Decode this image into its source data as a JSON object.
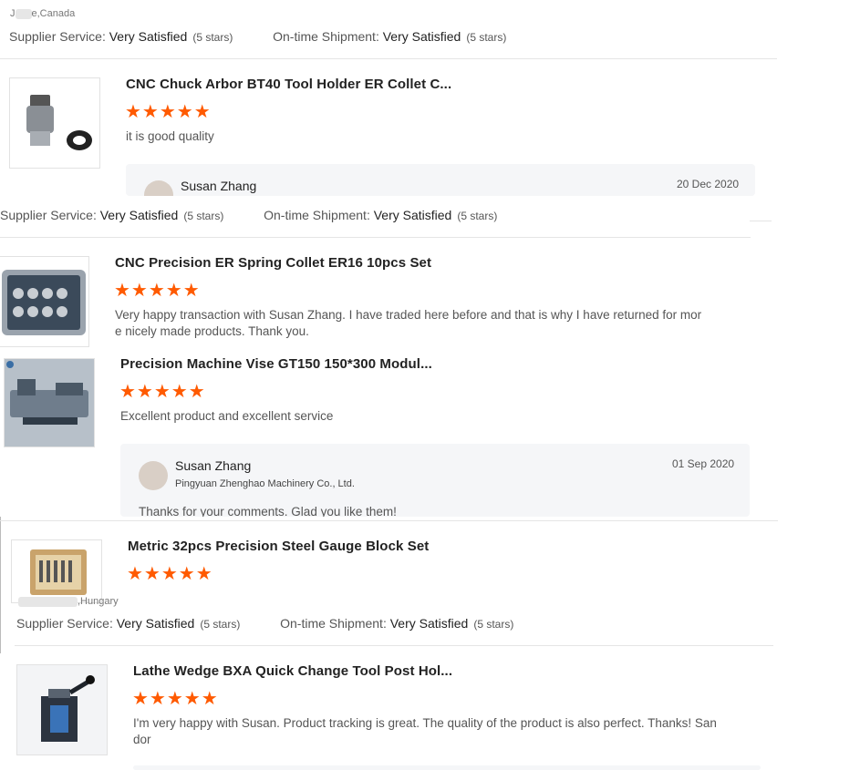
{
  "ratings_labels": {
    "supplier_service": "Supplier Service:",
    "ontime_shipment": "On-time Shipment:",
    "value": "Very Satisfied",
    "stars": "(5 stars)"
  },
  "star_glyphs": "★★★★★",
  "colors": {
    "accent": "#ff5a00",
    "reply_bg": "#f5f6f8"
  },
  "reviews": [
    {
      "location_prefix": "J",
      "location_suffix": "e,Canada"
    },
    {
      "title": "CNC Chuck Arbor BT40 Tool Holder ER Collet C...",
      "comment": "it is good quality",
      "rating": 5,
      "reply": {
        "name": "Susan Zhang",
        "date": "20 Dec 2020"
      },
      "thumb_icon": "tool-holder-icon"
    },
    {
      "title": "CNC Precision ER Spring Collet ER16 10pcs Set",
      "comment_line1": "Very happy transaction with Susan Zhang. I have traded here before and that is why I have returned for mor",
      "comment_line2": "e nicely made products.   Thank you.",
      "rating": 5,
      "thumb_icon": "collet-case-icon"
    },
    {
      "title": "Precision Machine Vise GT150 150*300 Modul...",
      "comment": "Excellent product and excellent service",
      "rating": 5,
      "reply": {
        "name": "Susan Zhang",
        "company": "Pingyuan Zhenghao Machinery Co., Ltd.",
        "date": "01 Sep 2020",
        "text": "Thanks for your comments. Glad you like them!"
      },
      "thumb_icon": "machine-vise-icon"
    },
    {
      "title": "Metric 32pcs Precision Steel Gauge Block Set",
      "rating": 5,
      "location_suffix": ",Hungary",
      "thumb_icon": "gauge-block-box-icon"
    },
    {
      "title": "Lathe Wedge BXA Quick Change Tool Post Hol...",
      "comment_line1": "I'm very happy with Susan. Product tracking is great. The quality of the product is also perfect. Thanks! San",
      "comment_line2": "dor",
      "rating": 5,
      "thumb_icon": "tool-post-icon"
    }
  ]
}
